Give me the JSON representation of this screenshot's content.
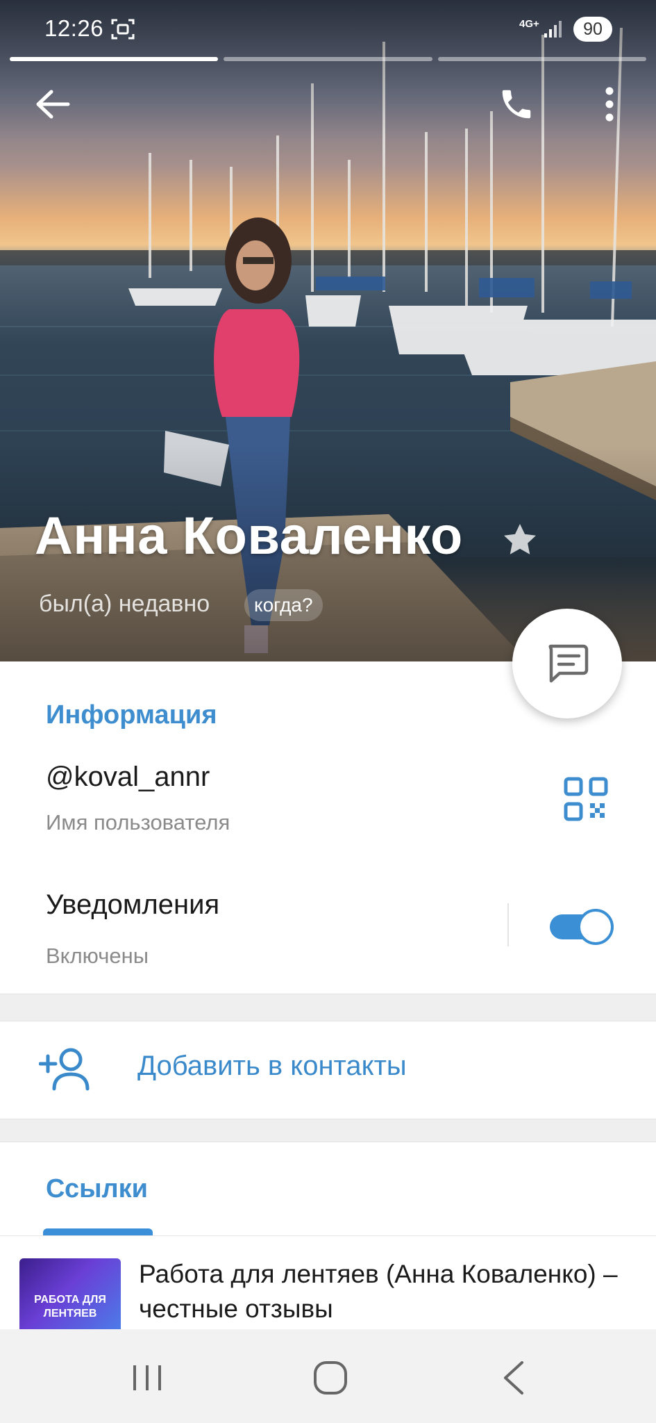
{
  "status_bar": {
    "time": "12:26",
    "network": "4G+",
    "battery": "90"
  },
  "story": {
    "segments": 3,
    "active_index": 0
  },
  "profile": {
    "name": "Анна Коваленко",
    "last_seen": "был(а) недавно",
    "when_chip": "когда?"
  },
  "info": {
    "section_title": "Информация",
    "username": "@koval_annr",
    "username_caption": "Имя пользователя",
    "notifications_label": "Уведомления",
    "notifications_state": "Включены",
    "notifications_enabled": true
  },
  "actions": {
    "add_contact": "Добавить в контакты"
  },
  "links": {
    "section_title": "Ссылки",
    "items": [
      {
        "thumb_text": "РАБОТА ДЛЯ ЛЕНТЯЕВ",
        "title": "Работа для лентяев (Анна Коваленко) – честные отзывы"
      }
    ]
  },
  "icons": {
    "back": "arrow-left-icon",
    "call": "phone-icon",
    "more": "more-vertical-icon",
    "star": "star-icon",
    "message": "message-icon",
    "qr": "qr-code-icon",
    "add_contact": "add-user-icon",
    "nav_recents": "recents-icon",
    "nav_home": "home-icon",
    "nav_back": "chevron-left-icon"
  },
  "colors": {
    "accent": "#3d8dcf",
    "toggle_on": "#3b8fd4",
    "text_primary": "#1a1a1a",
    "text_secondary": "#8a8a8a"
  }
}
